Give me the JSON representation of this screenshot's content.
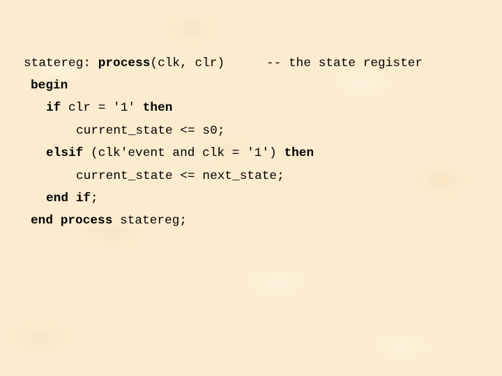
{
  "slide": {
    "background_color": "#fbeccf",
    "text_color": "#000000",
    "code": {
      "line1": {
        "label": "statereg:",
        "kw_process": "process",
        "args": "(clk, clr)",
        "comment": "-- the state register"
      },
      "line2": {
        "kw_begin": "begin"
      },
      "line3": {
        "kw_if": "if",
        "condition": " clr = '1' ",
        "kw_then": "then"
      },
      "line4": {
        "statement": "current_state <= s0;"
      },
      "line5": {
        "kw_elsif": "elsif",
        "condition": " (clk'event and clk = '1') ",
        "kw_then": "then"
      },
      "line6": {
        "statement": "current_state <= next_state;"
      },
      "line7": {
        "kw_end": "end",
        "kw_if": "if",
        "terminator": ";"
      },
      "line8": {
        "kw_end": "end",
        "kw_process": "process",
        "name": " statereg;"
      }
    }
  }
}
